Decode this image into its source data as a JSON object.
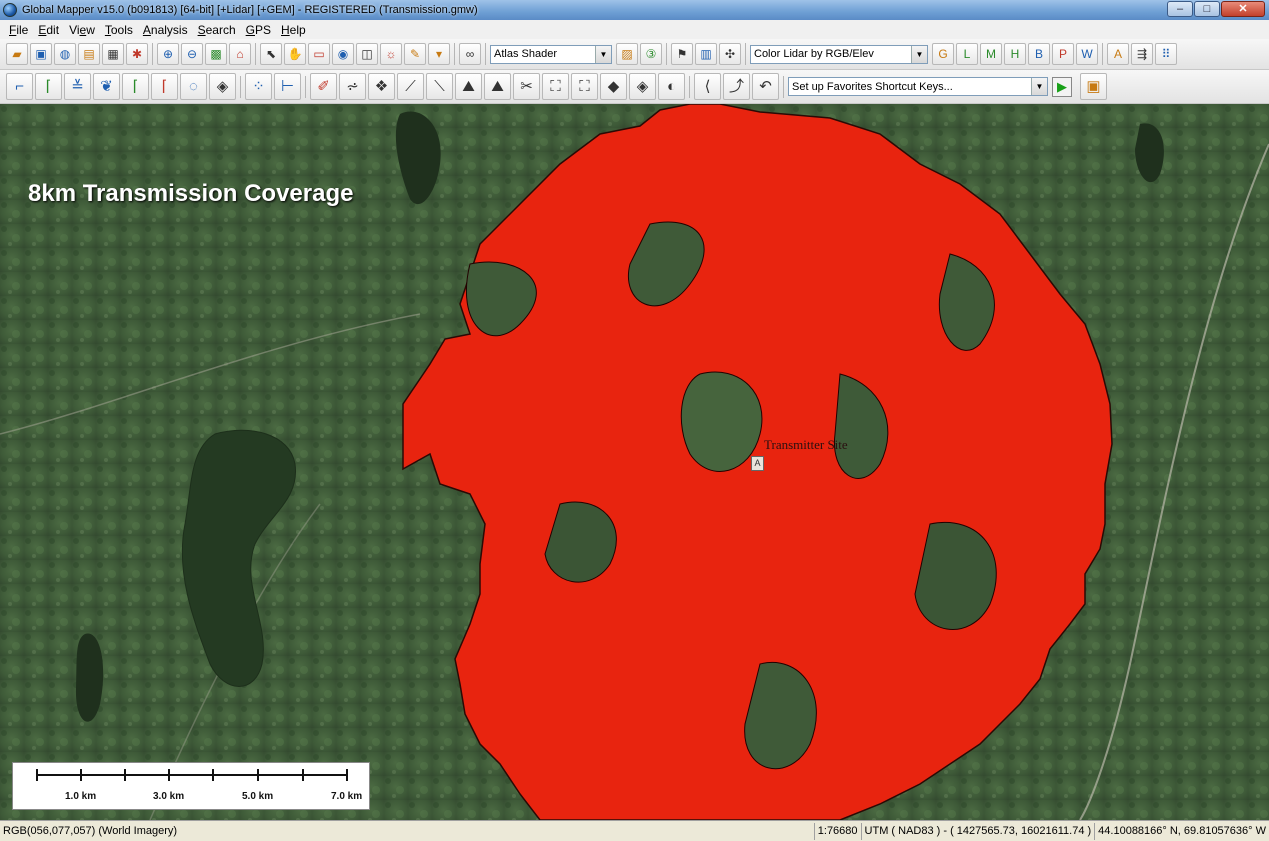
{
  "window": {
    "title": "Global Mapper v15.0 (b091813) [64-bit] [+Lidar] [+GEM] - REGISTERED (Transmission.gmw)",
    "minimize": "–",
    "maximize": "□",
    "close": "✕"
  },
  "menu": [
    {
      "u": "F",
      "rest": "ile"
    },
    {
      "u": "E",
      "rest": "dit"
    },
    {
      "pre": "Vi",
      "u": "e",
      "rest": "w"
    },
    {
      "u": "T",
      "rest": "ools"
    },
    {
      "u": "A",
      "rest": "nalysis"
    },
    {
      "u": "S",
      "rest": "earch"
    },
    {
      "u": "G",
      "rest": "PS"
    },
    {
      "u": "H",
      "rest": "elp"
    }
  ],
  "toolbar1": {
    "shader_combo": "Atlas Shader",
    "lidar_combo": "Color Lidar by RGB/Elev"
  },
  "toolbar2": {
    "favorites_combo": "Set up Favorites Shortcut Keys..."
  },
  "map": {
    "title": "8km Transmission Coverage",
    "site_label": "Transmitter Site",
    "site_marker": "A",
    "coverage_color": "#e8240f",
    "scale_labels": [
      "1.0 km",
      "3.0 km",
      "5.0 km",
      "7.0 km"
    ]
  },
  "status": {
    "pixel": "RGB(056,077,057) (World Imagery)",
    "scale": "1:76680",
    "projection": "UTM ( NAD83 ) - ( 1427565.73, 16021611.74 )",
    "latlon": "44.10088166° N, 69.81057636° W"
  }
}
